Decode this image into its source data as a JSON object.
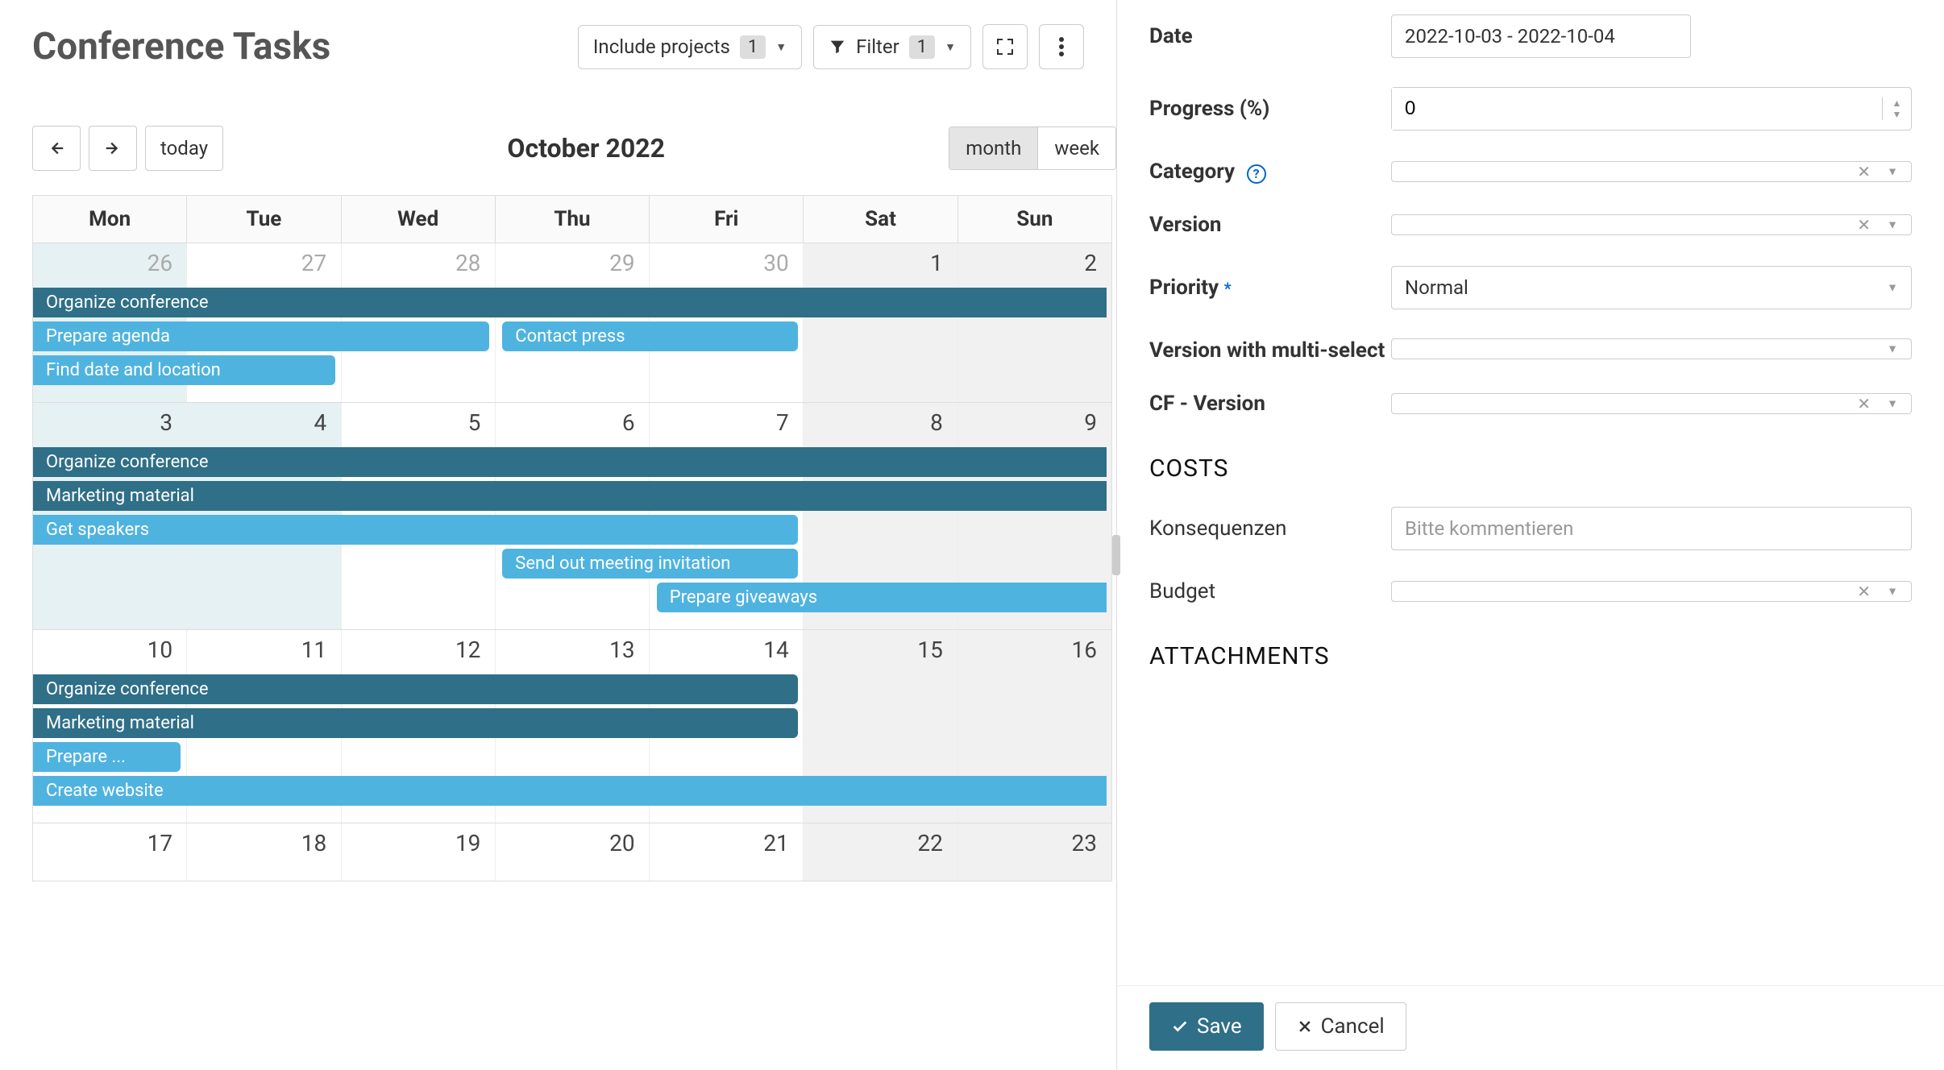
{
  "header": {
    "title": "Conference Tasks",
    "include_projects_label": "Include projects",
    "include_projects_count": "1",
    "filter_label": "Filter",
    "filter_count": "1"
  },
  "calnav": {
    "today_label": "today",
    "month_label": "October 2022",
    "view_month": "month",
    "view_week": "week"
  },
  "days_of_week": [
    "Mon",
    "Tue",
    "Wed",
    "Thu",
    "Fri",
    "Sat",
    "Sun"
  ],
  "weeks": [
    {
      "days": [
        {
          "n": "26",
          "muted": true,
          "bg": "teal"
        },
        {
          "n": "27",
          "muted": true
        },
        {
          "n": "28",
          "muted": true
        },
        {
          "n": "29",
          "muted": true
        },
        {
          "n": "30",
          "muted": true
        },
        {
          "n": "1",
          "bg": "grey"
        },
        {
          "n": "2",
          "bg": "grey"
        }
      ],
      "events": [
        {
          "label": "Organize conference",
          "start": 0,
          "span": 7,
          "cls": "dark off-left off-right"
        },
        {
          "label": "Prepare agenda",
          "start": 0,
          "span": 3,
          "cls": "light off-left",
          "extra": [
            {
              "label": "Contact press",
              "start": 3,
              "span": 2,
              "cls": "light"
            }
          ]
        },
        {
          "label": "Find date and location",
          "start": 0,
          "span": 2,
          "cls": "light off-left"
        }
      ]
    },
    {
      "days": [
        {
          "n": "3",
          "bg": "teal"
        },
        {
          "n": "4",
          "bg": "teal"
        },
        {
          "n": "5"
        },
        {
          "n": "6"
        },
        {
          "n": "7"
        },
        {
          "n": "8",
          "bg": "grey"
        },
        {
          "n": "9",
          "bg": "grey"
        }
      ],
      "events": [
        {
          "label": "Organize conference",
          "start": 0,
          "span": 7,
          "cls": "dark off-left off-right"
        },
        {
          "label": "Marketing material",
          "start": 0,
          "span": 7,
          "cls": "dark off-left off-right"
        },
        {
          "label": "Get speakers",
          "start": 0,
          "span": 5,
          "cls": "light off-left"
        },
        {
          "label": "Send out meeting invitation",
          "start": 3,
          "span": 2,
          "cls": "light"
        },
        {
          "label": "Prepare giveaways",
          "start": 4,
          "span": 3,
          "cls": "light off-right"
        }
      ]
    },
    {
      "days": [
        {
          "n": "10"
        },
        {
          "n": "11"
        },
        {
          "n": "12"
        },
        {
          "n": "13"
        },
        {
          "n": "14"
        },
        {
          "n": "15",
          "bg": "grey"
        },
        {
          "n": "16",
          "bg": "grey"
        }
      ],
      "events": [
        {
          "label": "Organize conference",
          "start": 0,
          "span": 5,
          "cls": "dark off-left"
        },
        {
          "label": "Marketing material",
          "start": 0,
          "span": 5,
          "cls": "dark off-left"
        },
        {
          "label": "Prepare ...",
          "start": 0,
          "span": 1,
          "cls": "light off-left"
        },
        {
          "label": "Create website",
          "start": 0,
          "span": 7,
          "cls": "light off-left off-right"
        }
      ]
    },
    {
      "days": [
        {
          "n": "17"
        },
        {
          "n": "18"
        },
        {
          "n": "19"
        },
        {
          "n": "20"
        },
        {
          "n": "21"
        },
        {
          "n": "22",
          "bg": "grey"
        },
        {
          "n": "23",
          "bg": "grey"
        }
      ],
      "events": []
    }
  ],
  "form": {
    "date_label": "Date",
    "date_value": "2022-10-03 - 2022-10-04",
    "progress_label": "Progress (%)",
    "progress_value": "0",
    "category_label": "Category",
    "category_value": "",
    "version_label": "Version",
    "version_value": "",
    "priority_label": "Priority",
    "priority_value": "Normal",
    "multisel_label": "Version with multi-select",
    "multisel_value": "",
    "cfversion_label": "CF - Version",
    "cfversion_value": "",
    "costs_heading": "COSTS",
    "konseq_label": "Konsequenzen",
    "konseq_value": "Bitte kommentieren",
    "budget_label": "Budget",
    "budget_value": "",
    "attach_heading": "ATTACHMENTS",
    "save_label": "Save",
    "cancel_label": "Cancel"
  }
}
